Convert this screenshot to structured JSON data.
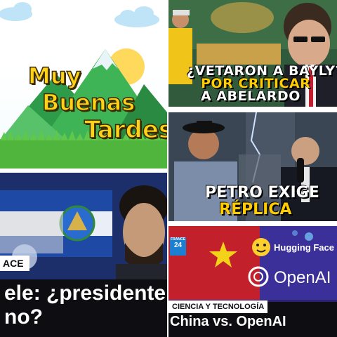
{
  "tiles": [
    {
      "id": "greeting",
      "text_lines": [
        "Muy",
        "Buenas",
        "Tardes"
      ]
    },
    {
      "id": "bayly",
      "text_lines": [
        "¿VETARON A BAYLY?",
        "POR CRITICAR",
        "A ABELARDO"
      ]
    },
    {
      "id": "petro",
      "text_lines": [
        "PETRO EXIGE",
        "RÉPLICA"
      ]
    },
    {
      "id": "bukele",
      "tag": "ACE",
      "headline_lines": [
        "ele: ¿presidente",
        "no?"
      ]
    },
    {
      "id": "china-openai",
      "channel_logo": [
        "FRANCE",
        "24"
      ],
      "category": "CIENCIA Y TECNOLOGÍA",
      "title": "China vs. OpenAI",
      "brands": [
        "Hugging Face",
        "OpenAI"
      ]
    }
  ],
  "colors": {
    "yellow_text": "#ffd21a",
    "white_text": "#ffffff",
    "dark_bar": "#0d0d12"
  }
}
